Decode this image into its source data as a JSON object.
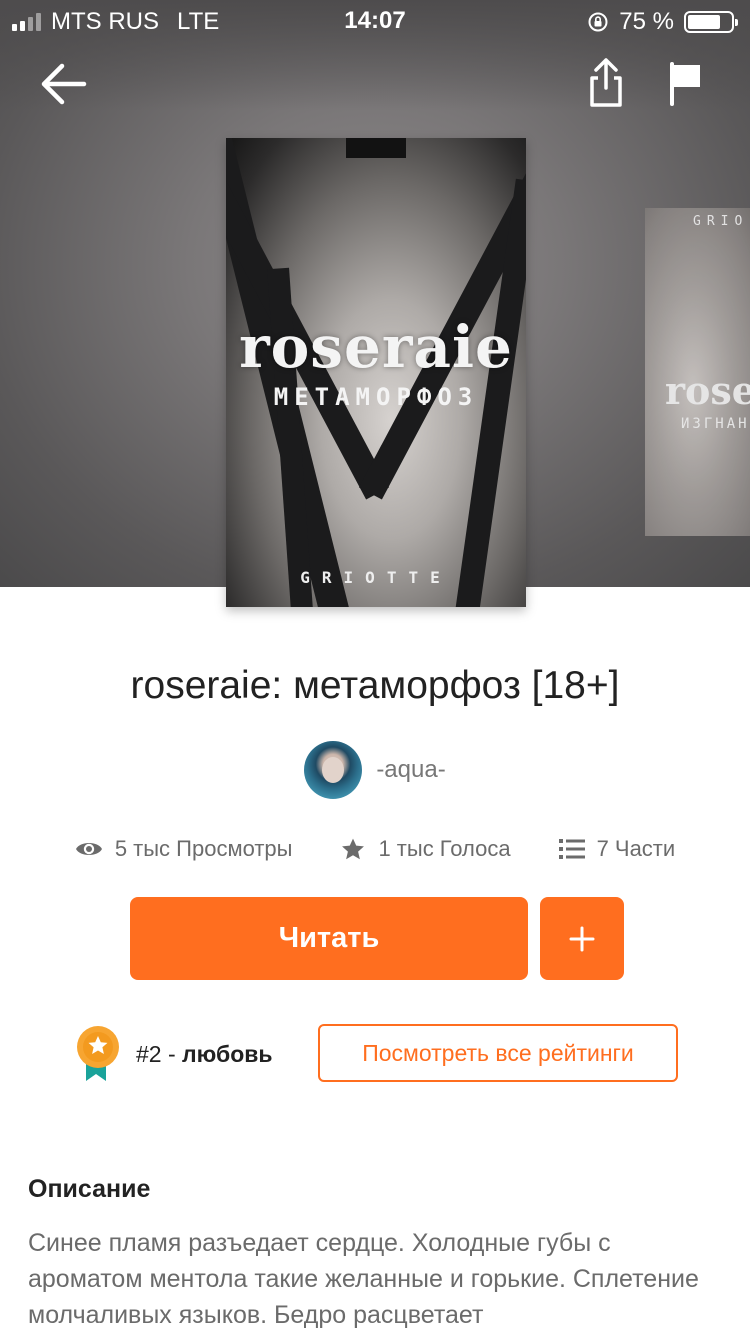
{
  "status_bar": {
    "carrier": "MTS RUS",
    "network": "LTE",
    "time": "14:07",
    "battery_percent": "75 %",
    "battery_level": 0.75
  },
  "nav": {
    "back_icon": "arrow-left-icon",
    "share_icon": "share-icon",
    "flag_icon": "flag-icon"
  },
  "cover": {
    "title": "roseraie",
    "subtitle": "МЕТАМОРФОЗ",
    "author": "GRIOTTE"
  },
  "next_cover": {
    "title": "rose",
    "subtitle": "ИЗГНАНИ",
    "author": "GRIO"
  },
  "story": {
    "title": "roseraie: метаморфоз [18+]",
    "author": "-aqua-"
  },
  "stats": {
    "views": "5 тыс Просмотры",
    "votes": "1 тыс Голоса",
    "parts": "7 Части"
  },
  "actions": {
    "read_label": "Читать",
    "add_label": "+"
  },
  "ranking": {
    "rank": "#2",
    "separator": " - ",
    "category": "любовь",
    "view_all_label": "Посмотреть все рейтинги"
  },
  "description": {
    "heading": "Описание",
    "text": "Синее пламя разъедает сердце. Холодные губы с ароматом ментола такие желанные и горькие. Сплетение молчаливых языков. Бедро расцветает"
  },
  "colors": {
    "accent": "#ff6e1f",
    "badge_orange": "#f7a531",
    "badge_ribbon": "#1aa39a"
  }
}
